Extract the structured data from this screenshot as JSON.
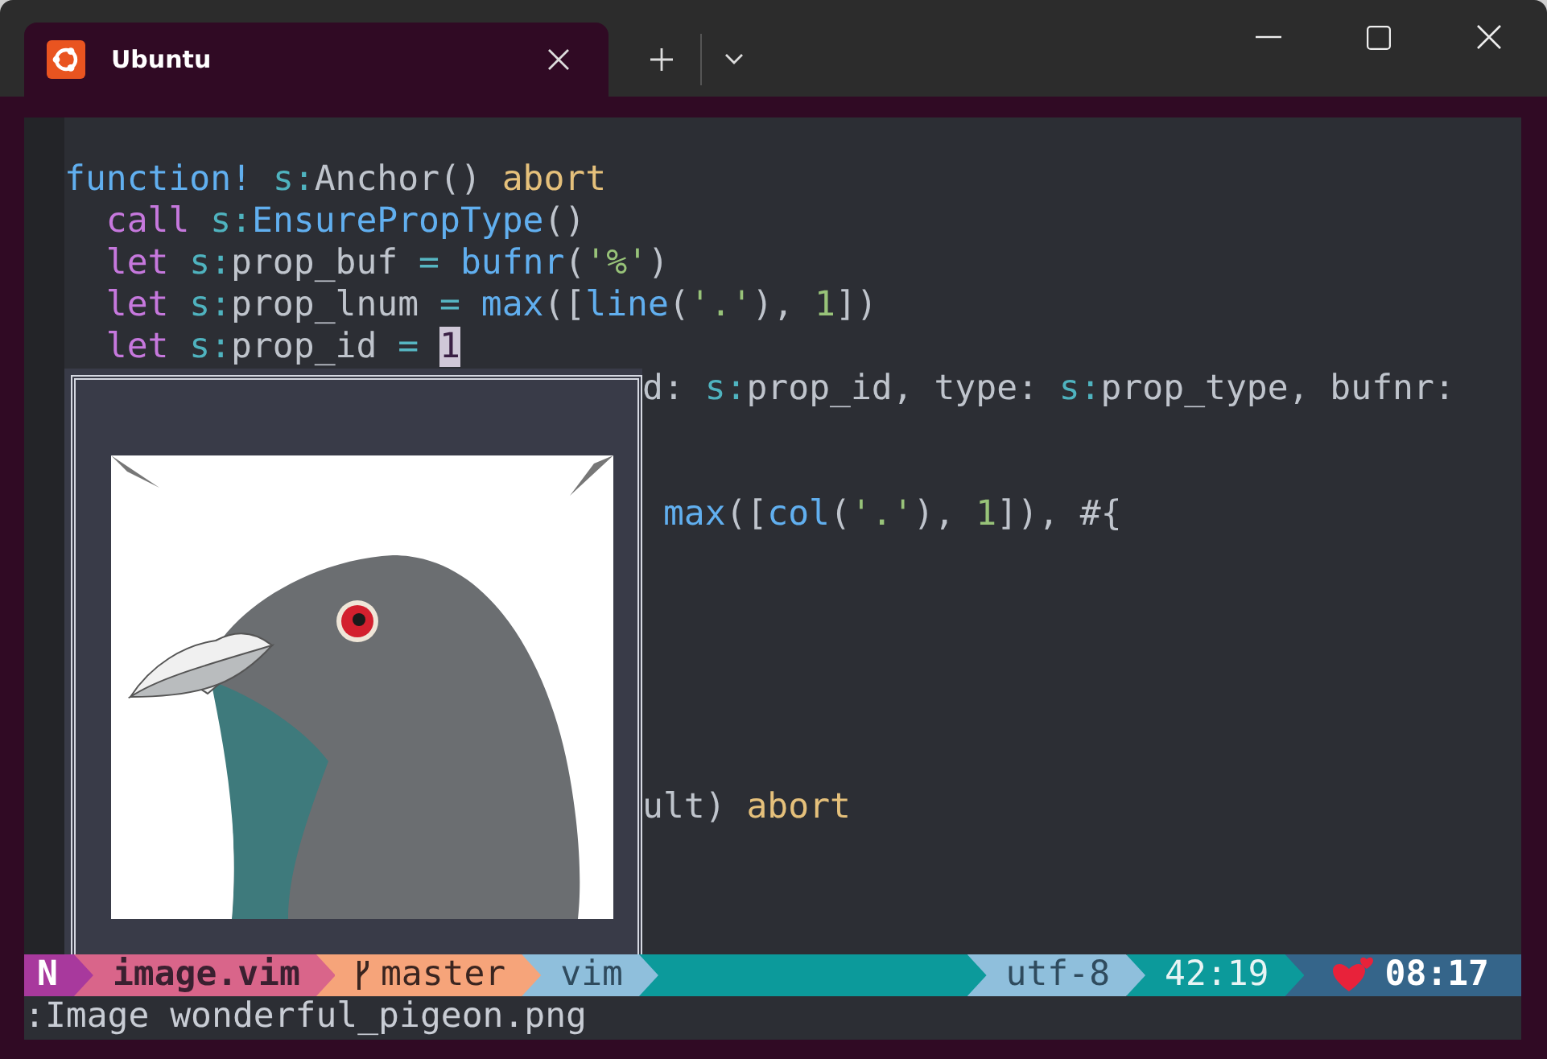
{
  "window": {
    "tab_title": "Ubuntu"
  },
  "editor": {
    "lines_above": [
      {
        "kind": "blank"
      },
      {
        "kind": "code",
        "indented": false,
        "segments": [
          {
            "kind": "func",
            "text": "function! "
          },
          {
            "kind": "scope",
            "text": "s:"
          },
          {
            "kind": "text",
            "text": "Anchor() "
          },
          {
            "kind": "modifier",
            "text": "abort"
          }
        ]
      },
      {
        "kind": "code",
        "indented": true,
        "segments": [
          {
            "kind": "keyword",
            "text": "call "
          },
          {
            "kind": "scope",
            "text": "s:"
          },
          {
            "kind": "func",
            "text": "EnsurePropType"
          },
          {
            "kind": "text",
            "text": "()"
          }
        ]
      },
      {
        "kind": "code",
        "indented": true,
        "segments": [
          {
            "kind": "keyword",
            "text": "let "
          },
          {
            "kind": "scope",
            "text": "s:"
          },
          {
            "kind": "text",
            "text": "prop_buf "
          },
          {
            "kind": "operator",
            "text": "= "
          },
          {
            "kind": "func",
            "text": "bufnr"
          },
          {
            "kind": "text",
            "text": "("
          },
          {
            "kind": "string",
            "text": "'%'"
          },
          {
            "kind": "text",
            "text": ")"
          }
        ]
      },
      {
        "kind": "code",
        "indented": true,
        "segments": [
          {
            "kind": "keyword",
            "text": "let "
          },
          {
            "kind": "scope",
            "text": "s:"
          },
          {
            "kind": "text",
            "text": "prop_lnum "
          },
          {
            "kind": "operator",
            "text": "= "
          },
          {
            "kind": "func",
            "text": "max"
          },
          {
            "kind": "text",
            "text": "(["
          },
          {
            "kind": "func",
            "text": "line"
          },
          {
            "kind": "text",
            "text": "("
          },
          {
            "kind": "string",
            "text": "'.'"
          },
          {
            "kind": "text",
            "text": "), "
          },
          {
            "kind": "number",
            "text": "1"
          },
          {
            "kind": "text",
            "text": "])"
          }
        ]
      },
      {
        "kind": "code",
        "indented": true,
        "segments": [
          {
            "kind": "keyword",
            "text": "let "
          },
          {
            "kind": "scope",
            "text": "s:"
          },
          {
            "kind": "text",
            "text": "prop_id "
          },
          {
            "kind": "operator",
            "text": "= "
          },
          {
            "kind": "cursor",
            "text": "1"
          }
        ]
      }
    ],
    "lines_beside_popup": [
      {
        "kind": "code",
        "segments": [
          {
            "kind": "text",
            "text": "d: "
          },
          {
            "kind": "scope",
            "text": "s:"
          },
          {
            "kind": "text",
            "text": "prop_id, type: "
          },
          {
            "kind": "scope",
            "text": "s:"
          },
          {
            "kind": "text",
            "text": "prop_type, bufnr:"
          }
        ]
      },
      {
        "kind": "blank"
      },
      {
        "kind": "blank"
      },
      {
        "kind": "code",
        "segments": [
          {
            "kind": "func",
            "text": " max"
          },
          {
            "kind": "text",
            "text": "(["
          },
          {
            "kind": "func",
            "text": "col"
          },
          {
            "kind": "text",
            "text": "("
          },
          {
            "kind": "string",
            "text": "'.'"
          },
          {
            "kind": "text",
            "text": "), "
          },
          {
            "kind": "number",
            "text": "1"
          },
          {
            "kind": "text",
            "text": "]), #{"
          }
        ]
      },
      {
        "kind": "blank"
      },
      {
        "kind": "blank"
      },
      {
        "kind": "blank"
      },
      {
        "kind": "blank"
      },
      {
        "kind": "blank"
      },
      {
        "kind": "blank"
      },
      {
        "kind": "code",
        "segments": [
          {
            "kind": "text",
            "text": "ult) "
          },
          {
            "kind": "modifier",
            "text": "abort"
          }
        ]
      },
      {
        "kind": "blank"
      },
      {
        "kind": "blank"
      },
      {
        "kind": "blank"
      }
    ]
  },
  "status_line": [
    {
      "kind": "mode",
      "text": "N",
      "color": "#a8399d"
    },
    {
      "kind": "file",
      "text": "image.vim",
      "color": "#d9658a"
    },
    {
      "kind": "branch",
      "text": "master",
      "color": "#f6a47a"
    },
    {
      "kind": "filetype",
      "text": "vim",
      "color": "#8fbfdc"
    },
    {
      "kind": "filler",
      "color": "#0c9a9b"
    },
    {
      "kind": "encoding",
      "text": "utf-8",
      "color": "#8fbfdc"
    },
    {
      "kind": "position",
      "text": "42:19",
      "color": "#0c9a9b"
    },
    {
      "kind": "clock",
      "text": "08:17",
      "color": "#35658a"
    }
  ],
  "command_line": ":Image wonderful_pigeon.png"
}
